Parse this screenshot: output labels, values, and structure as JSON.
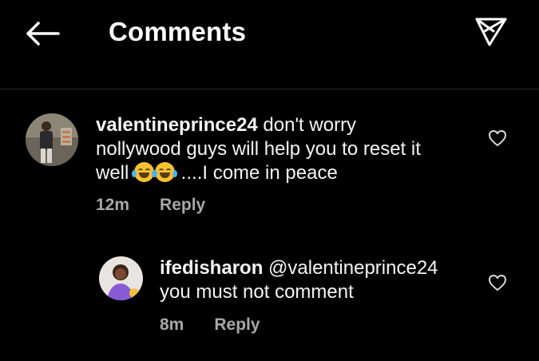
{
  "header": {
    "title": "Comments",
    "back_icon": "arrow-left-icon",
    "share_icon": "paper-plane-icon"
  },
  "comments": [
    {
      "username": "valentineprince24",
      "text_line1": " don't worry",
      "text_line2": "nollywood guys will help you to reset it",
      "text_line3_start": "well ",
      "text_line3_end": " ....I come in peace",
      "emoji": "tears-of-joy-emoji",
      "time": "12m",
      "reply_label": "Reply",
      "like_icon": "heart-outline-icon"
    },
    {
      "username": "ifedisharon",
      "mention": " @valentineprince24",
      "text_line2": "you must not comment",
      "time": "8m",
      "reply_label": "Reply",
      "like_icon": "heart-outline-icon"
    }
  ],
  "colors": {
    "background": "#000000",
    "text": "#f5f5f5",
    "muted": "#a8a8a8",
    "divider": "#262626"
  }
}
